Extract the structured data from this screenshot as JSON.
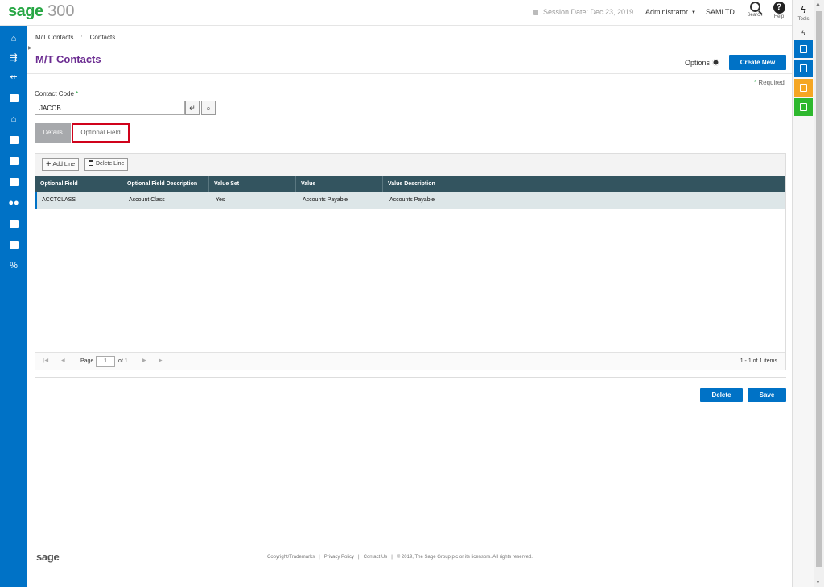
{
  "header": {
    "logo_brand": "sage",
    "logo_version": "300",
    "session": "Session Date:  Dec 23, 2019",
    "user": "Administrator",
    "company": "SAMLTD",
    "search_label": "Search",
    "help_label": "Help"
  },
  "tools": {
    "label": "Tools"
  },
  "breadcrumb": {
    "parent": "M/T Contacts",
    "separator": ":",
    "current": "Contacts"
  },
  "page": {
    "title": "M/T Contacts",
    "options_label": "Options",
    "create_new_label": "Create New",
    "required_note": "Required"
  },
  "form": {
    "contact_code_label": "Contact Code",
    "contact_code_value": "JACOB"
  },
  "tabs": [
    {
      "label": "Details"
    },
    {
      "label": "Optional Field"
    }
  ],
  "grid": {
    "add_line_label": "Add Line",
    "delete_line_label": "Delete Line",
    "columns": [
      "Optional Field",
      "Optional Field Description",
      "Value Set",
      "Value",
      "Value Description"
    ],
    "rows": [
      [
        "ACCTCLASS",
        "Account Class",
        "Yes",
        "Accounts Payable",
        "Accounts Payable"
      ]
    ],
    "pager": {
      "page_label": "Page",
      "page_value": "1",
      "of_label": "of 1",
      "count": "1 - 1 of 1 items"
    }
  },
  "actions": {
    "delete_label": "Delete",
    "save_label": "Save"
  },
  "footer": {
    "logo": "sage",
    "links": [
      "Copyright/Trademarks",
      "Privacy Policy",
      "Contact Us",
      "© 2019, The Sage Group plc or its licensors. All rights reserved."
    ]
  },
  "colors": {
    "brand_blue": "#0072c6",
    "title_purple": "#6b2c91",
    "grid_header": "#33545f",
    "highlight_red": "#d0021b"
  }
}
